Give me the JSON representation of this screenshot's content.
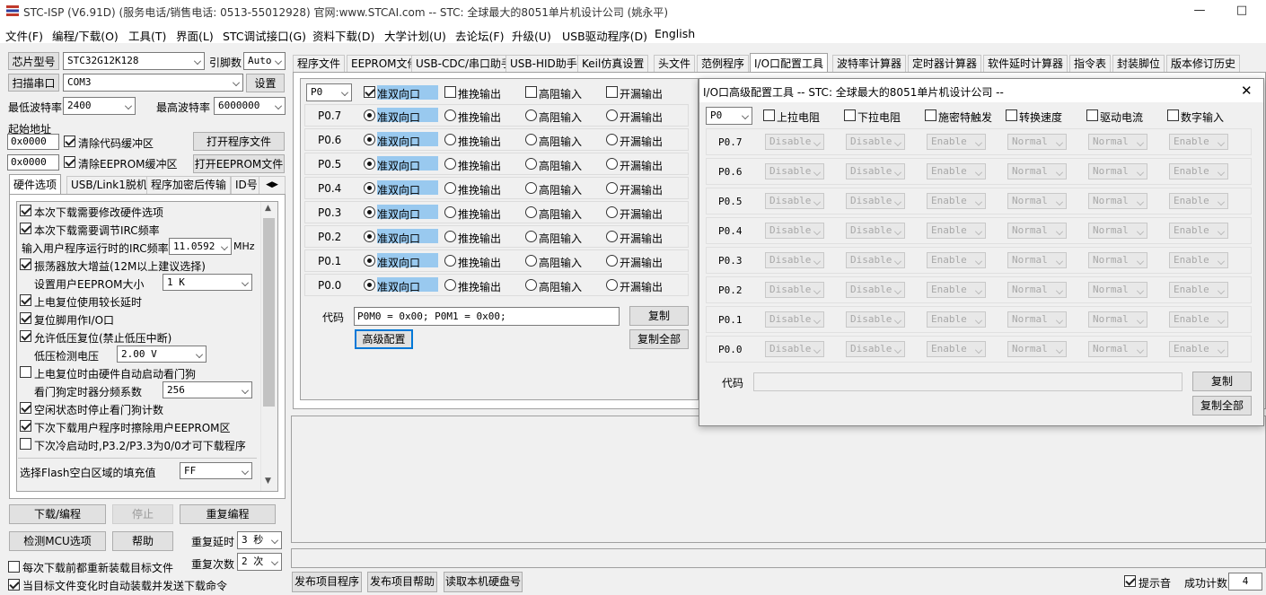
{
  "title": {
    "text": "STC-ISP (V6.91D) (服务电话/销售电话: 0513-55012928) 官网:www.STCAI.com  -- STC: 全球最大的8051单片机设计公司 (姚永平)",
    "minimize": "—",
    "maximize": "□"
  },
  "menu": [
    "文件(F)",
    "编程/下载(O)",
    "工具(T)",
    "界面(L)",
    "STC调试接口(G)",
    "资料下载(D)",
    "大学计划(U)",
    "去论坛(F)",
    "升级(U)",
    "USB驱动程序(D)",
    "English"
  ],
  "left": {
    "chip_label": "芯片型号",
    "chip_value": "STC32G12K128",
    "pin_label": "引脚数",
    "pin_value": "Auto",
    "scan_label": "扫描串口",
    "port_value": "COM3",
    "settings_label": "设置",
    "min_baud_label": "最低波特率",
    "min_baud_value": "2400",
    "max_baud_label": "最高波特率",
    "max_baud_value": "6000000",
    "start_addr_label": "起始地址",
    "addr1": "0x0000",
    "clear_code_label": "清除代码缓冲区",
    "open_prog_label": "打开程序文件",
    "addr2": "0x0000",
    "clear_eeprom_label": "清除EEPROM缓冲区",
    "open_eeprom_label": "打开EEPROM文件",
    "tabs": [
      "硬件选项",
      "USB/Link1脱机",
      "程序加密后传输",
      "ID号"
    ],
    "options": [
      {
        "label": "本次下载需要修改硬件选项",
        "checked": true
      },
      {
        "label": "本次下载需要调节IRC频率",
        "checked": true
      },
      {
        "label": "输入用户程序运行时的IRC频率",
        "freq": "11.0592",
        "unit": "MHz"
      },
      {
        "label": "振荡器放大增益(12M以上建议选择)",
        "checked": true
      },
      {
        "label": "设置用户EEPROM大小",
        "value": "1   K"
      },
      {
        "label": "上电复位使用较长延时",
        "checked": true
      },
      {
        "label": "复位脚用作I/O口",
        "checked": true
      },
      {
        "label": "允许低压复位(禁止低压中断)",
        "checked": true
      },
      {
        "label": "低压检测电压",
        "value": "2.00 V"
      },
      {
        "label": "上电复位时由硬件自动启动看门狗",
        "checked": false
      },
      {
        "label": "看门狗定时器分频系数",
        "value": "256"
      },
      {
        "label": "空闲状态时停止看门狗计数",
        "checked": true
      },
      {
        "label": "下次下载用户程序时擦除用户EEPROM区",
        "checked": true
      },
      {
        "label": "下次冷启动时,P3.2/P3.3为0/0才可下载程序",
        "checked": false
      }
    ],
    "flash_fill_label": "选择Flash空白区域的填充值",
    "flash_fill_value": "FF",
    "download_label": "下载/编程",
    "stop_label": "停止",
    "reprogram_label": "重复编程",
    "detect_label": "检测MCU选项",
    "help_label": "帮助",
    "delay_label": "重复延时",
    "delay_value": "3 秒",
    "reload_label": "每次下载前都重新装载目标文件",
    "count_label": "重复次数",
    "count_value": "2 次",
    "auto_label": "当目标文件变化时自动装载并发送下载命令"
  },
  "main_tabs": [
    "程序文件",
    "EEPROM文件",
    "USB-CDC/串口助手",
    "USB-HID助手",
    "Keil仿真设置",
    "头文件",
    "范例程序",
    "I/O口配置工具",
    "波特率计算器",
    "定时器计算器",
    "软件延时计算器",
    "指令表",
    "封装脚位",
    "版本修订历史"
  ],
  "io": {
    "port": "P0",
    "headers": [
      "准双向口",
      "推挽输出",
      "高阻输入",
      "开漏输出"
    ],
    "pins": [
      "P0.7",
      "P0.6",
      "P0.5",
      "P0.4",
      "P0.3",
      "P0.2",
      "P0.1",
      "P0.0"
    ],
    "code_label": "代码",
    "code_value": "P0M0 = 0x00;  P0M1 = 0x00;",
    "copy_label": "复制",
    "advanced_label": "高级配置",
    "copy_all_label": "复制全部"
  },
  "dialog": {
    "title": "I/O口高级配置工具 -- STC: 全球最大的8051单片机设计公司 --",
    "close": "✕",
    "port": "P0",
    "headers": [
      "上拉电阻",
      "下拉电阻",
      "施密特触发",
      "转换速度",
      "驱动电流",
      "数字输入"
    ],
    "pins": [
      "P0.7",
      "P0.6",
      "P0.5",
      "P0.4",
      "P0.3",
      "P0.2",
      "P0.1",
      "P0.0"
    ],
    "values": [
      "Disable",
      "Disable",
      "Enable",
      "Normal",
      "Normal",
      "Enable"
    ],
    "code_label": "代码",
    "copy_label": "复制",
    "copy_all_label": "复制全部"
  },
  "bottom": {
    "publish_prog": "发布项目程序",
    "publish_help": "发布项目帮助",
    "read_disk": "读取本机硬盘号",
    "sound_label": "提示音",
    "success_label": "成功计数",
    "success_value": "4"
  }
}
